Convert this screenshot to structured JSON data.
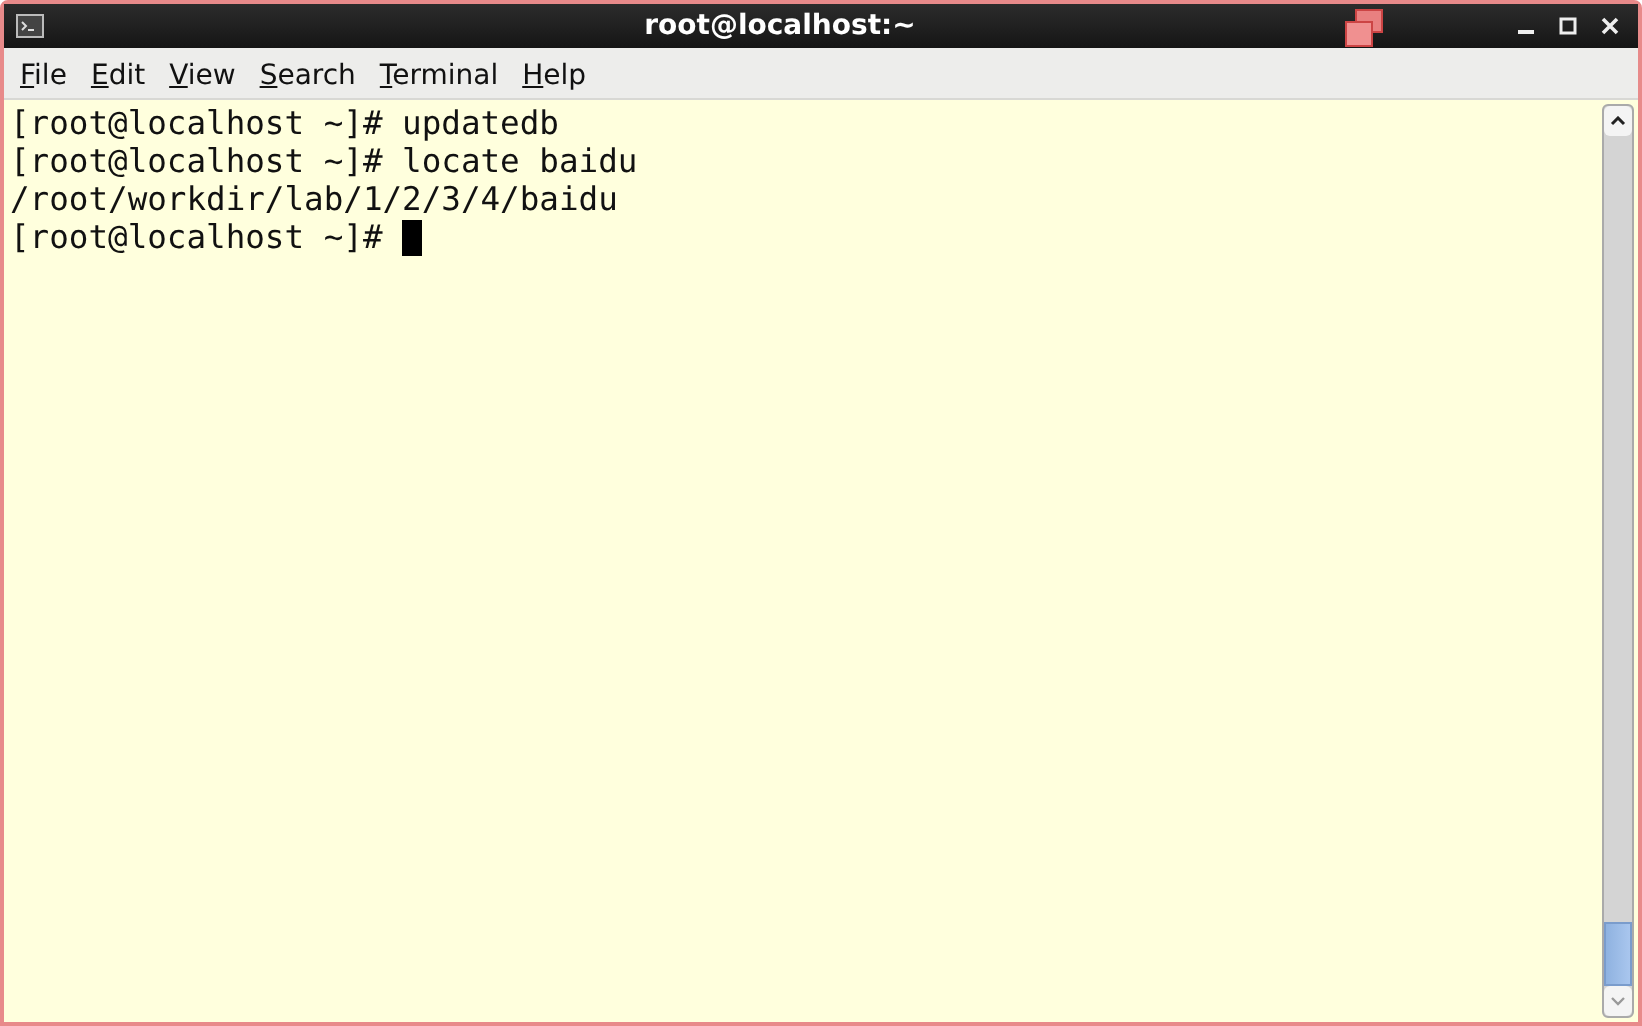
{
  "window": {
    "title": "root@localhost:~"
  },
  "menu": [
    {
      "label": "File"
    },
    {
      "label": "Edit"
    },
    {
      "label": "View"
    },
    {
      "label": "Search"
    },
    {
      "label": "Terminal"
    },
    {
      "label": "Help"
    }
  ],
  "terminal": {
    "lines": [
      "[root@localhost ~]# updatedb",
      "[root@localhost ~]# locate baidu",
      "/root/workdir/lab/1/2/3/4/baidu",
      "[root@localhost ~]# "
    ]
  }
}
